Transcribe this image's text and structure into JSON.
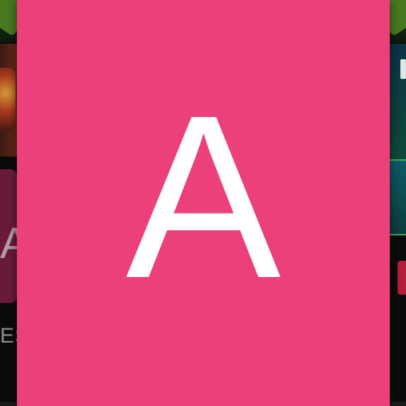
{
  "background_app": {
    "left_tile_letter": "A",
    "left_label_fragment": "ES"
  },
  "avatar_card": {
    "letter": "A",
    "color": "#ec407a",
    "text_color": "#ffffff"
  }
}
